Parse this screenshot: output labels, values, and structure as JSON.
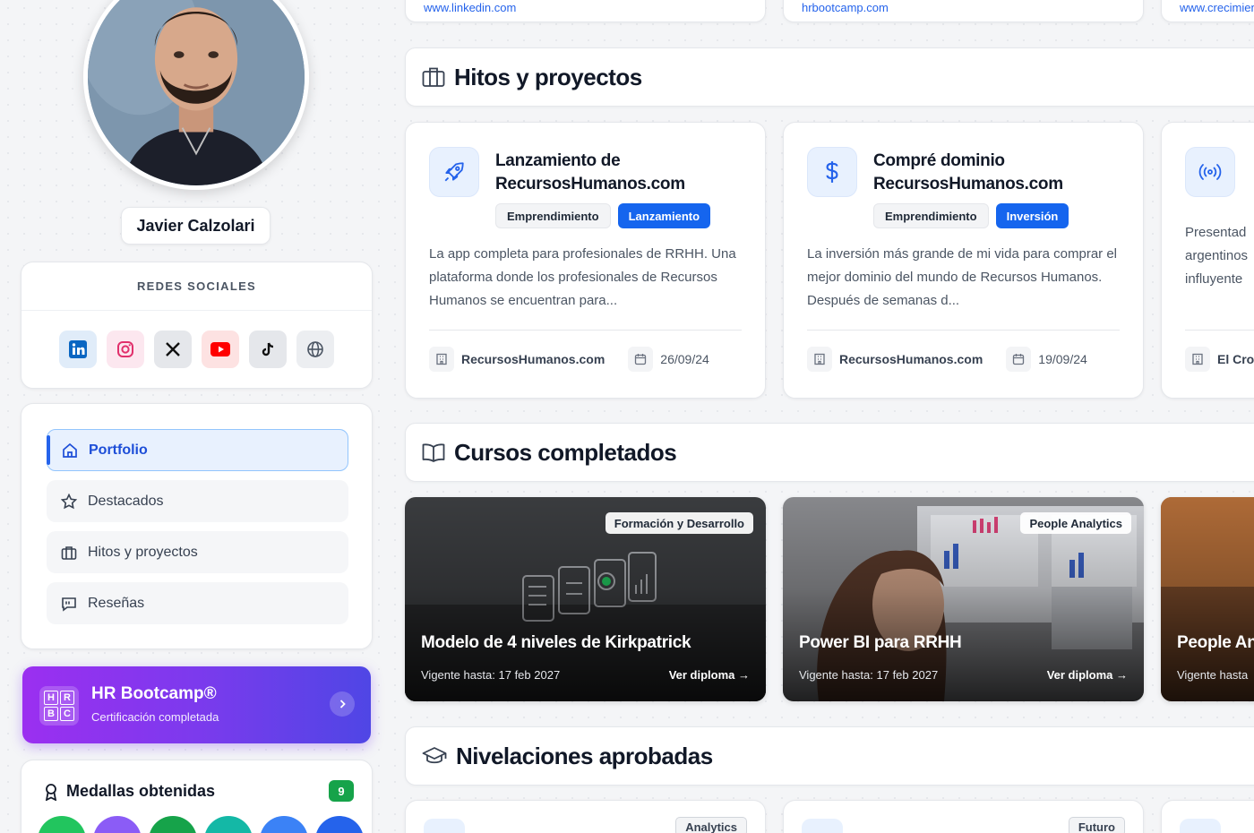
{
  "profile": {
    "name": "Javier Calzolari"
  },
  "social": {
    "title": "REDES SOCIALES",
    "items": [
      {
        "icon": "linkedin-icon",
        "color": "#0a66c2"
      },
      {
        "icon": "instagram-icon",
        "color": "#e1306c"
      },
      {
        "icon": "x-icon",
        "color": "#111111"
      },
      {
        "icon": "youtube-icon",
        "color": "#ff0000"
      },
      {
        "icon": "tiktok-icon",
        "color": "#111111"
      },
      {
        "icon": "globe-icon",
        "color": "#4b5563"
      }
    ]
  },
  "nav": {
    "items": [
      {
        "label": "Portfolio",
        "icon": "home-icon",
        "active": true
      },
      {
        "label": "Destacados",
        "icon": "star-icon",
        "active": false
      },
      {
        "label": "Hitos y proyectos",
        "icon": "briefcase-icon",
        "active": false
      },
      {
        "label": "Reseñas",
        "icon": "quote-icon",
        "active": false
      }
    ]
  },
  "bootcamp": {
    "logo_letters": [
      "H",
      "R",
      "B",
      "C"
    ],
    "title": "HR Bootcamp®",
    "subtitle": "Certificación completada"
  },
  "medals": {
    "title": "Medallas obtenidas",
    "count": "9",
    "colors": [
      "#22c55e",
      "#8b5cf6",
      "#16a34a",
      "#14b8a6",
      "#3b82f6",
      "#2563eb"
    ]
  },
  "top_links": [
    "www.linkedin.com",
    "hrbootcamp.com",
    "www.crecimiento.com"
  ],
  "projects_section": {
    "title": "Hitos y proyectos",
    "items": [
      {
        "icon": "rocket-icon",
        "title_line1": "Lanzamiento de",
        "title_line2": "RecursosHumanos.com",
        "tag1": "Emprendimiento",
        "tag2": "Lanzamiento",
        "desc": "La app completa para profesionales de RRHH. Una plataforma donde los profesionales de Recursos Humanos se encuentran para...",
        "company": "RecursosHumanos.com",
        "date": "26/09/24"
      },
      {
        "icon": "dollar-icon",
        "title_line1": "Compré dominio",
        "title_line2": "RecursosHumanos.com",
        "tag1": "Emprendimiento",
        "tag2": "Inversión",
        "desc": "La inversión más grande de mi vida para comprar el mejor dominio del mundo de Recursos Humanos. Después de semanas d...",
        "company": "RecursosHumanos.com",
        "date": "19/09/24"
      },
      {
        "icon": "broadcast-icon",
        "title_line1": "",
        "title_line2": "",
        "tag1": "",
        "tag2": "",
        "desc": "Presentad argentinos influyente",
        "company": "El Cro",
        "date": ""
      }
    ]
  },
  "courses_section": {
    "title": "Cursos completados",
    "items": [
      {
        "category": "Formación y Desarrollo",
        "title": "Modelo de 4 niveles de Kirkpatrick",
        "valid": "Vigente hasta: 17 feb 2027",
        "link": "Ver diploma →"
      },
      {
        "category": "People Analytics",
        "title": "Power BI para RRHH",
        "valid": "Vigente hasta: 17 feb 2027",
        "link": "Ver diploma →"
      },
      {
        "category": "",
        "title": "People An",
        "valid": "Vigente hasta",
        "link": ""
      }
    ]
  },
  "levels_section": {
    "title": "Nivelaciones aprobadas",
    "tags": [
      "Analytics",
      "Futuro"
    ]
  }
}
